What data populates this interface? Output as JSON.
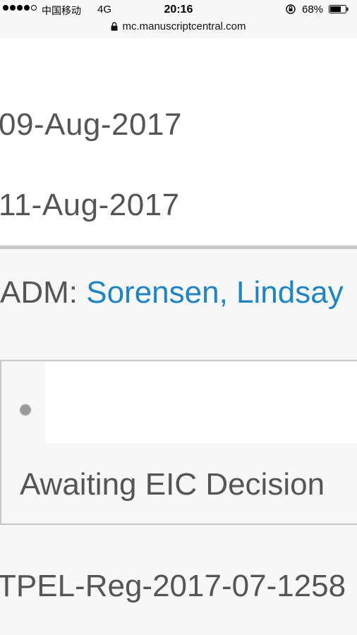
{
  "status_bar": {
    "carrier": "中国移动",
    "network": "4G",
    "time": "20:16",
    "battery_percent": "68%",
    "battery_level": 0.68
  },
  "url_bar": {
    "url": "mc.manuscriptcentral.com"
  },
  "dates": {
    "first": "09-Aug-2017",
    "second": "11-Aug-2017"
  },
  "admin": {
    "label": "ADM:",
    "name": "Sorensen, Lindsay"
  },
  "status": {
    "text": "Awaiting EIC Decision"
  },
  "manuscript": {
    "id": "TPEL-Reg-2017-07-1258"
  },
  "colors": {
    "link": "#1f84c1",
    "text": "#555555",
    "divider": "#c9c9c9"
  }
}
